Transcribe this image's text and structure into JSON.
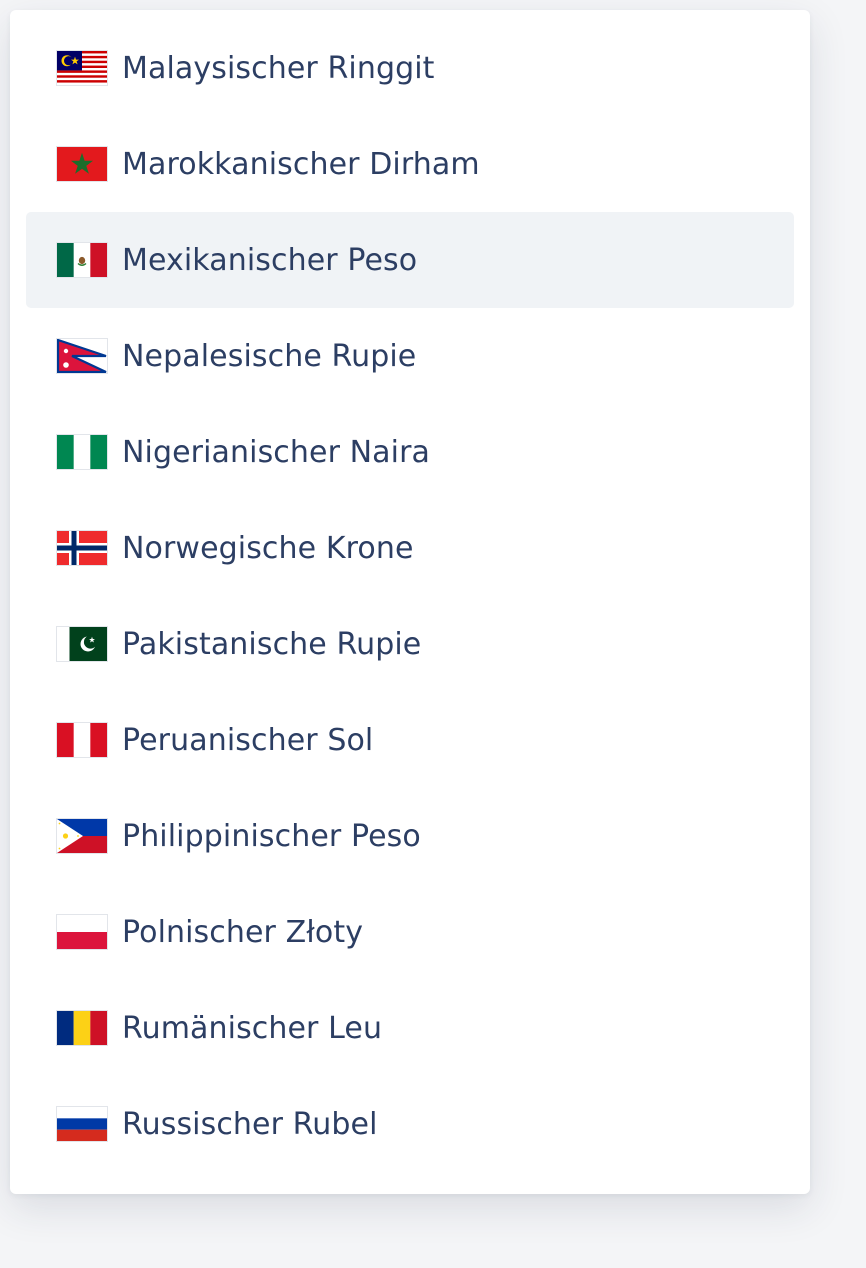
{
  "currency_list": {
    "items": [
      {
        "label": "Malaysischer Ringgit",
        "flag": "malaysia-flag-icon"
      },
      {
        "label": "Marokkanischer Dirham",
        "flag": "morocco-flag-icon"
      },
      {
        "label": "Mexikanischer Peso",
        "flag": "mexico-flag-icon",
        "highlighted": true
      },
      {
        "label": "Nepalesische Rupie",
        "flag": "nepal-flag-icon"
      },
      {
        "label": "Nigerianischer Naira",
        "flag": "nigeria-flag-icon"
      },
      {
        "label": "Norwegische Krone",
        "flag": "norway-flag-icon"
      },
      {
        "label": "Pakistanische Rupie",
        "flag": "pakistan-flag-icon"
      },
      {
        "label": "Peruanischer Sol",
        "flag": "peru-flag-icon"
      },
      {
        "label": "Philippinischer Peso",
        "flag": "philippines-flag-icon"
      },
      {
        "label": "Polnischer Złoty",
        "flag": "poland-flag-icon"
      },
      {
        "label": "Rumänischer Leu",
        "flag": "romania-flag-icon"
      },
      {
        "label": "Russischer Rubel",
        "flag": "russia-flag-icon"
      }
    ]
  },
  "colors": {
    "text": "#2c3e63",
    "highlight_bg": "#f0f3f6",
    "panel_bg": "#ffffff"
  }
}
